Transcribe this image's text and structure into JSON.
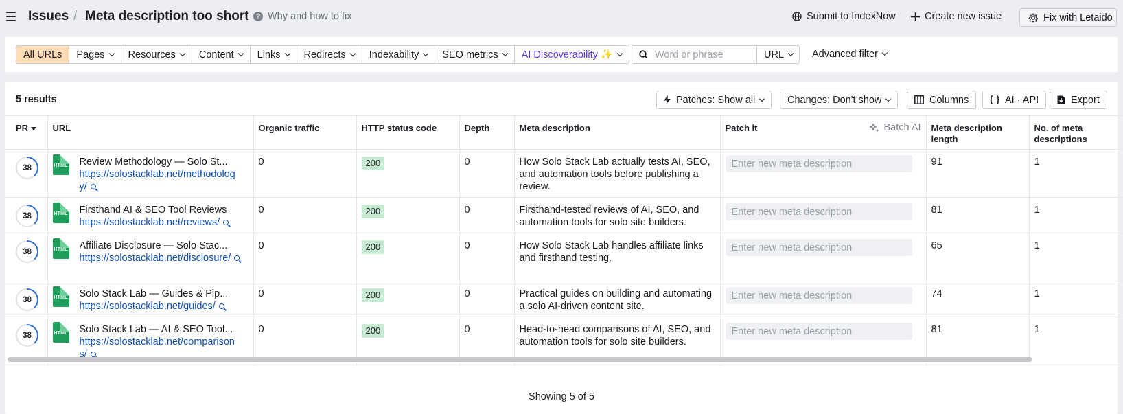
{
  "topbar": {
    "root_crumb": "Issues",
    "separator": "/",
    "title": "Meta description too short",
    "help_text": "Why and how to fix",
    "submit_indexnow": "Submit to IndexNow",
    "create_issue": "Create new issue",
    "fix_with": "Fix with Letaido"
  },
  "filters": {
    "segments": [
      {
        "label": "All URLs",
        "active": true
      },
      {
        "label": "Pages"
      },
      {
        "label": "Resources"
      },
      {
        "label": "Content"
      },
      {
        "label": "Links"
      },
      {
        "label": "Redirects"
      },
      {
        "label": "Indexability"
      },
      {
        "label": "SEO metrics"
      },
      {
        "label": "AI Discoverability ✨"
      }
    ],
    "search_placeholder": "Word or phrase",
    "search_scope": "URL",
    "advanced": "Advanced filter"
  },
  "results": {
    "count_label": "5 results",
    "patches_btn": "Patches: Show all",
    "changes_btn": "Changes: Don't show",
    "columns_btn": "Columns",
    "api_btn": "AI · API",
    "export_btn": "Export"
  },
  "table": {
    "headers": {
      "pr": "PR",
      "url": "URL",
      "organic": "Organic traffic",
      "http": "HTTP status code",
      "depth": "Depth",
      "meta": "Meta description",
      "patch": "Patch it",
      "batch_ai": "Batch AI",
      "meta_len": "Meta description length",
      "meta_count": "No. of meta descriptions"
    },
    "patch_placeholder": "Enter new meta description",
    "rows": [
      {
        "pr": "38",
        "page": "Review Methodology — Solo St...",
        "url": "https://solostacklab.net/methodology/",
        "organic": "0",
        "status": "200",
        "depth": "0",
        "meta": "How Solo Stack Lab actually tests AI, SEO, and automation tools before publishing a review.",
        "length": "91",
        "count": "1"
      },
      {
        "pr": "38",
        "page": "Firsthand AI & SEO Tool Reviews",
        "url": "https://solostacklab.net/reviews/",
        "organic": "0",
        "status": "200",
        "depth": "0",
        "meta": "Firsthand-tested reviews of AI, SEO, and automation tools for solo site builders.",
        "length": "81",
        "count": "1"
      },
      {
        "pr": "38",
        "page": "Affiliate Disclosure — Solo Stac...",
        "url": "https://solostacklab.net/disclosure/",
        "organic": "0",
        "status": "200",
        "depth": "0",
        "meta": "How Solo Stack Lab handles affiliate links and firsthand testing.",
        "length": "65",
        "count": "1"
      },
      {
        "pr": "38",
        "page": "Solo Stack Lab — Guides & Pip...",
        "url": "https://solostacklab.net/guides/",
        "organic": "0",
        "status": "200",
        "depth": "0",
        "meta": "Practical guides on building and automating a solo AI-driven content site.",
        "length": "74",
        "count": "1"
      },
      {
        "pr": "38",
        "page": "Solo Stack Lab — AI & SEO Tool...",
        "url": "https://solostacklab.net/comparisons/",
        "organic": "0",
        "status": "200",
        "depth": "0",
        "meta": "Head-to-head comparisons of AI, SEO, and automation tools for solo site builders.",
        "length": "81",
        "count": "1"
      }
    ]
  },
  "footer": {
    "showing": "Showing 5 of 5"
  },
  "colors": {
    "active_segment": "#ffdcb5",
    "ai_accent": "#5b3ce6",
    "link": "#1253b8",
    "status_ok": "#c6ead2",
    "html_icon": "#1e9e5a",
    "pr_ring": "#2f6fd8"
  },
  "icons": [
    "hamburger-icon",
    "question-icon",
    "globe-icon",
    "plus-icon",
    "letaido-icon",
    "search-icon",
    "chevron-down-icon",
    "lightning-icon",
    "columns-icon",
    "braces-icon",
    "export-icon",
    "sparkle-icon",
    "html-file-icon",
    "magnifier-icon"
  ]
}
